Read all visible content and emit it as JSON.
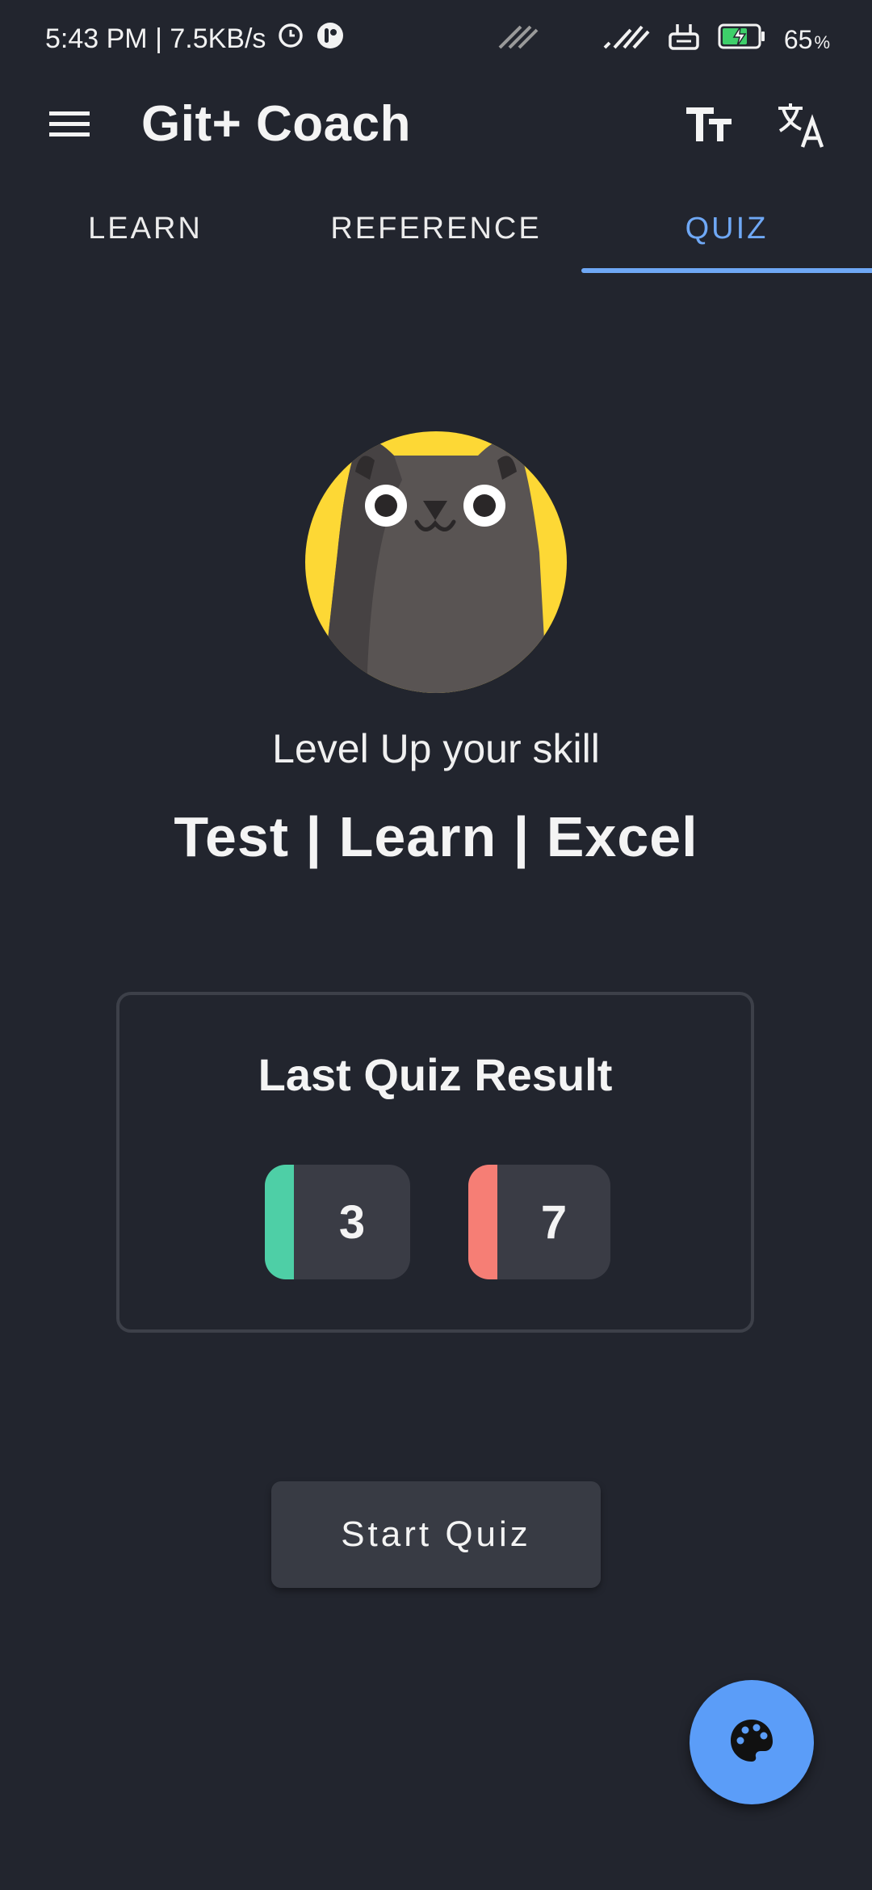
{
  "status_bar": {
    "time_speed": "5:43 PM | 7.5KB/s",
    "battery_percent": "65",
    "battery_suffix": "%",
    "icons": [
      "alarm-clock-icon",
      "notification-icon",
      "signal-icon",
      "signal-icon",
      "router-icon",
      "battery-charging-icon"
    ]
  },
  "app_bar": {
    "title": "Git+ Coach",
    "icons": [
      "menu-icon",
      "text-size-icon",
      "translate-icon"
    ]
  },
  "tabs": [
    {
      "label": "LEARN",
      "selected": false
    },
    {
      "label": "REFERENCE",
      "selected": false
    },
    {
      "label": "QUIZ",
      "selected": true
    }
  ],
  "main": {
    "tagline": "Level Up your skill",
    "motto": "Test | Learn | Excel",
    "mascot_icon": "cat-mascot-icon"
  },
  "result": {
    "title": "Last Quiz Result",
    "correct": "3",
    "wrong": "7",
    "correct_color": "#4ecfa6",
    "wrong_color": "#f67e75"
  },
  "start_button": {
    "label": "Start Quiz"
  },
  "fab": {
    "icon": "palette-icon",
    "color": "#5b9df8"
  },
  "colors": {
    "background": "#22252e",
    "accent": "#6fa8f5",
    "mascot_bg": "#fdd835"
  }
}
